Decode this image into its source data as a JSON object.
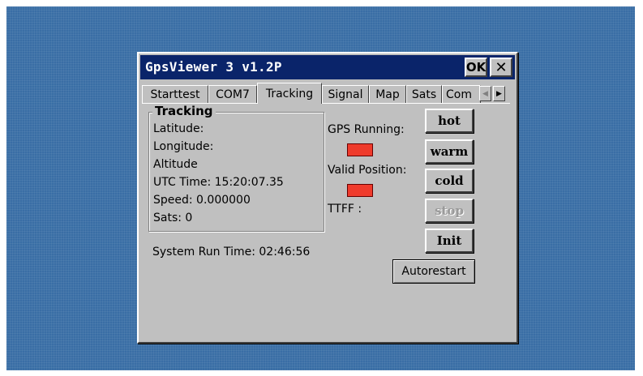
{
  "window": {
    "title": "GpsViewer 3 v1.2P",
    "ok_label": "OK",
    "close_label": "✕"
  },
  "tabs": [
    {
      "label": "Starttest",
      "active": false
    },
    {
      "label": "COM7",
      "active": false
    },
    {
      "label": "Tracking",
      "active": true
    },
    {
      "label": "Signal",
      "active": false
    },
    {
      "label": "Map",
      "active": false
    },
    {
      "label": "Sats",
      "active": false
    },
    {
      "label": "Com",
      "active": false
    }
  ],
  "tab_scroll": {
    "left": "◀",
    "right": "▶"
  },
  "tracking": {
    "group_title": "Tracking",
    "latitude": "Latitude:",
    "longitude": "Longitude:",
    "altitude": "Altitude",
    "utc_time": "UTC Time: 15:20:07.35",
    "speed": "Speed: 0.000000",
    "sats": "Sats: 0"
  },
  "status": {
    "gps_running_label": "GPS Running:",
    "valid_position_label": "Valid Position:",
    "ttff_label": "TTFF :",
    "indicator_color": "#ef3b2c"
  },
  "buttons": {
    "hot": "hot",
    "warm": "warm",
    "cold": "cold",
    "stop": "stop",
    "init": "Init",
    "autorestart": "Autorestart"
  },
  "system_run_time": "System Run Time: 02:46:56"
}
